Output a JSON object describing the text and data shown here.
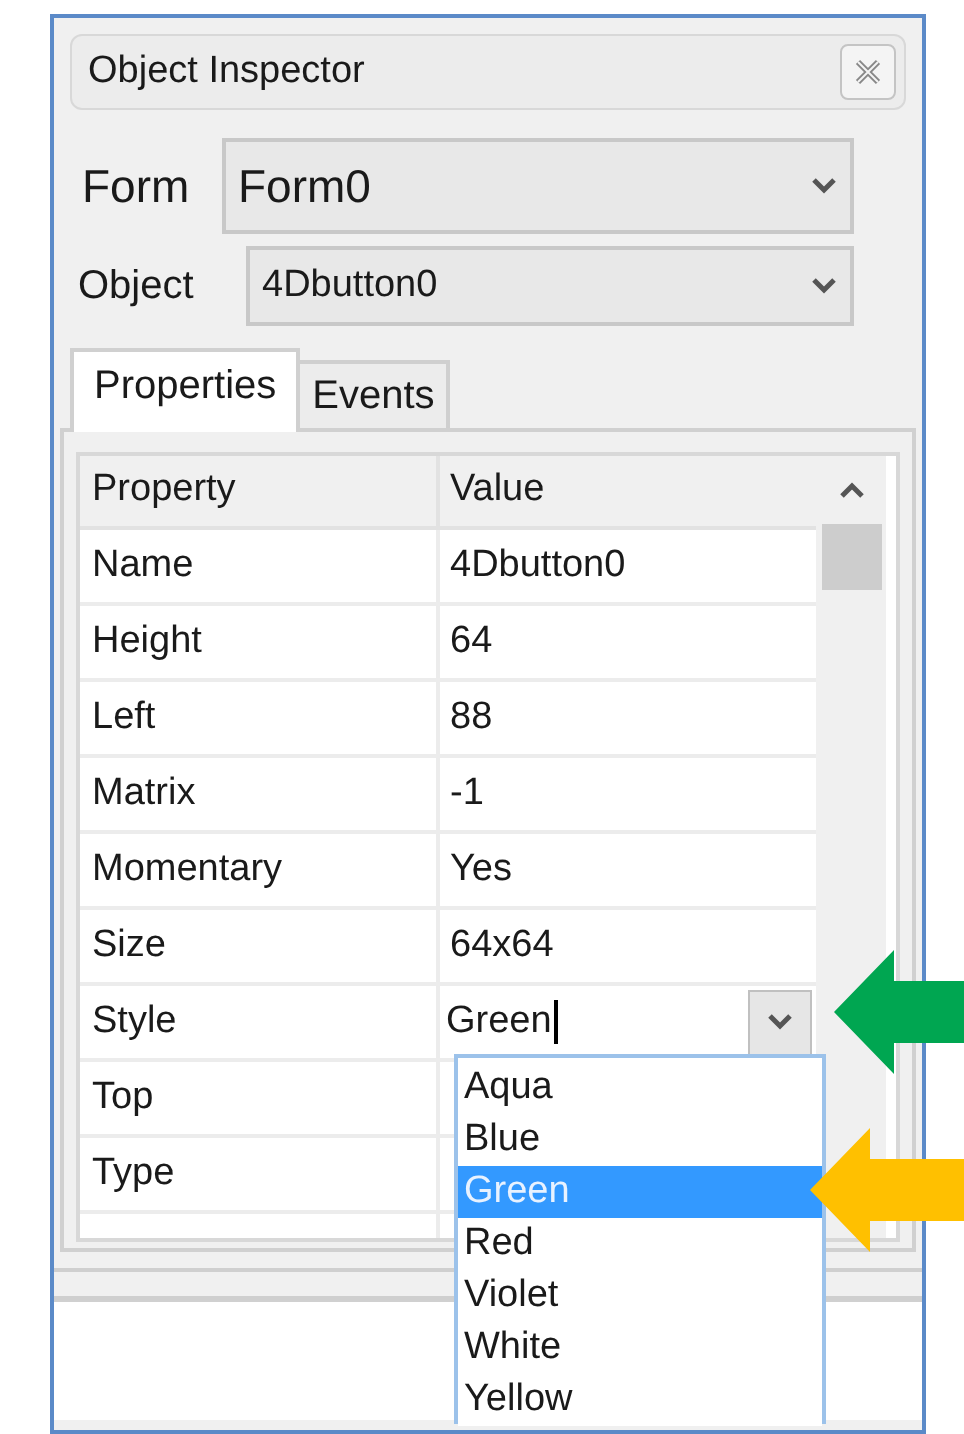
{
  "panel": {
    "title": "Object Inspector"
  },
  "form": {
    "label": "Form",
    "value": "Form0"
  },
  "object": {
    "label": "Object",
    "value": "4Dbutton0"
  },
  "tabs": [
    {
      "label": "Properties",
      "selected": true
    },
    {
      "label": "Events",
      "selected": false
    }
  ],
  "grid": {
    "columns": [
      "Property",
      "Value"
    ],
    "rows": [
      {
        "property": "Name",
        "value": "4Dbutton0",
        "kind": "text"
      },
      {
        "property": "Height",
        "value": "64",
        "kind": "text"
      },
      {
        "property": "Left",
        "value": "88",
        "kind": "text"
      },
      {
        "property": "Matrix",
        "value": "-1",
        "kind": "text"
      },
      {
        "property": "Momentary",
        "value": "Yes",
        "kind": "text"
      },
      {
        "property": "Size",
        "value": "64x64",
        "kind": "text"
      },
      {
        "property": "Style",
        "value": "Green",
        "kind": "dropdown"
      },
      {
        "property": "Top",
        "kind": "text"
      },
      {
        "property": "Type",
        "kind": "text"
      }
    ]
  },
  "dropdown": {
    "options": [
      {
        "label": "Aqua",
        "selected": false
      },
      {
        "label": "Blue",
        "selected": false
      },
      {
        "label": "Green",
        "selected": true
      },
      {
        "label": "Red",
        "selected": false
      },
      {
        "label": "Violet",
        "selected": false
      },
      {
        "label": "White",
        "selected": false
      },
      {
        "label": "Yellow",
        "selected": false
      }
    ]
  },
  "annotations": [
    {
      "kind": "arrow",
      "color": "#00a651"
    },
    {
      "kind": "arrow",
      "color": "#ffc000"
    }
  ]
}
